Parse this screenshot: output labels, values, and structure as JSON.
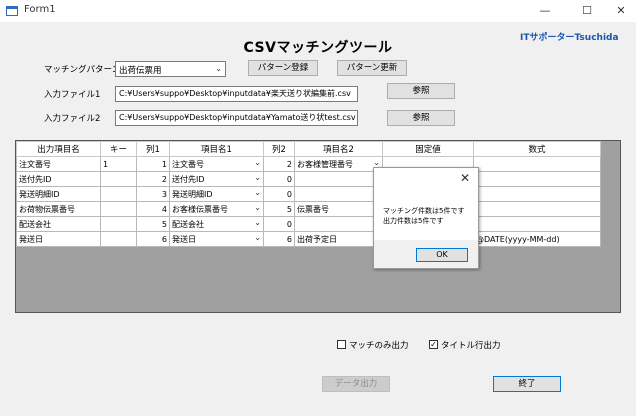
{
  "window": {
    "title": "Form1",
    "minimize": "—",
    "maximize": "☐",
    "close": "✕"
  },
  "header": {
    "title": "CSVマッチングツール",
    "brand": "ITサポーターTsuchida"
  },
  "pattern": {
    "label": "マッチングパターン",
    "selected": "出荷伝票用",
    "register_label": "パターン登録",
    "update_label": "パターン更新"
  },
  "input1": {
    "label": "入力ファイル1",
    "path": "C:¥Users¥suppo¥Desktop¥inputdata¥楽天送り状編集前.csv",
    "browse_label": "参照"
  },
  "input2": {
    "label": "入力ファイル2",
    "path": "C:¥Users¥suppo¥Desktop¥inputdata¥Yamato送り状test.csv",
    "browse_label": "参照"
  },
  "grid": {
    "columns": [
      "出力項目名",
      "キー",
      "列1",
      "項目名1",
      "列2",
      "項目名2",
      "固定値",
      "数式"
    ],
    "rows": [
      {
        "out": "注文番号",
        "key": "1",
        "col1": "1",
        "name1": "注文番号",
        "col2": "2",
        "name2": "お客様管理番号",
        "fixed": "",
        "formula": ""
      },
      {
        "out": "送付先ID",
        "key": "",
        "col1": "2",
        "name1": "送付先ID",
        "col2": "0",
        "name2": "",
        "fixed": "",
        "formula": ""
      },
      {
        "out": "発送明細ID",
        "key": "",
        "col1": "3",
        "name1": "発送明細ID",
        "col2": "0",
        "name2": "",
        "fixed": "",
        "formula": ""
      },
      {
        "out": "お荷物伝票番号",
        "key": "",
        "col1": "4",
        "name1": "お客様伝票番号",
        "col2": "5",
        "name2": "伝票番号",
        "fixed": "",
        "formula": ""
      },
      {
        "out": "配送会社",
        "key": "",
        "col1": "5",
        "name1": "配送会社",
        "col2": "0",
        "name2": "",
        "fixed": "",
        "formula": ""
      },
      {
        "out": "発送日",
        "key": "",
        "col1": "6",
        "name1": "発送日",
        "col2": "6",
        "name2": "出荷予定日",
        "fixed": "",
        "formula": "@DATE(yyyy-MM-dd)"
      }
    ]
  },
  "dialog": {
    "close": "✕",
    "line1": "マッチング件数は5件です",
    "line2": "出力件数は5件です",
    "ok_label": "OK"
  },
  "options": {
    "match_only_label": "マッチのみ出力",
    "match_only_checked": false,
    "title_row_label": "タイトル行出力",
    "title_row_checked": true,
    "check_mark": "✓"
  },
  "footer": {
    "export_label": "データ出力",
    "exit_label": "終了"
  },
  "colors": {
    "highlight": "#ffff00",
    "brand": "#1a55b0",
    "accent": "#0078d7"
  }
}
